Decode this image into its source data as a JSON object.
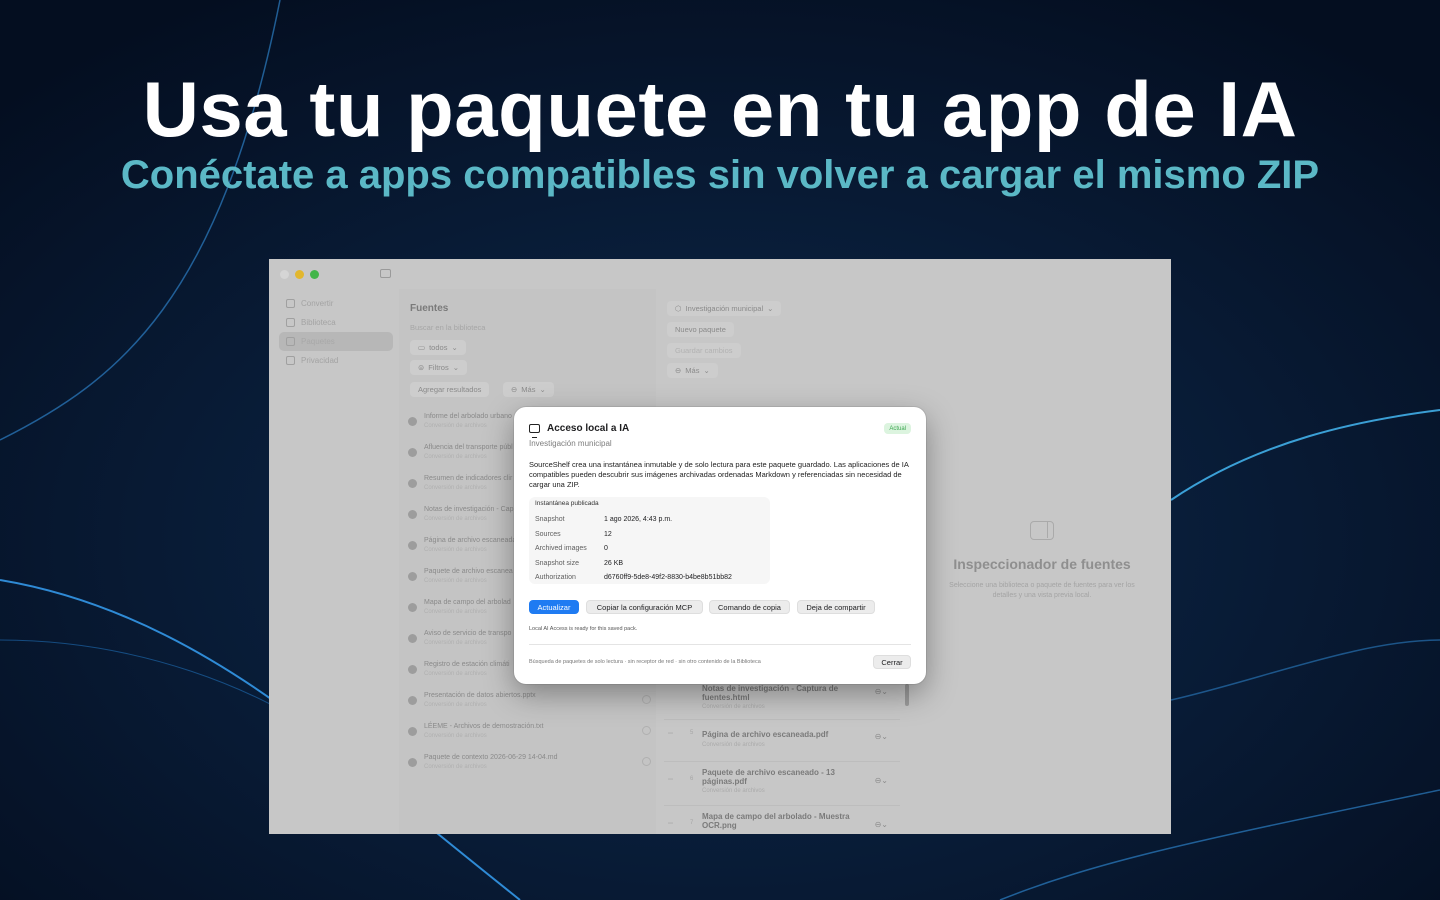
{
  "hero": {
    "headline": "Usa tu paquete en tu app de IA",
    "subheadline": "Conéctate a apps compatibles sin volver a cargar el mismo ZIP"
  },
  "colors": {
    "background": "#06142b",
    "accent_teal": "#5bb8c6",
    "primary_blue": "#1f7bf2",
    "badge_green": "#3ca650"
  },
  "sidebar": {
    "items": [
      {
        "label": "Convertir",
        "icon": "doc-icon"
      },
      {
        "label": "Biblioteca",
        "icon": "library-icon"
      },
      {
        "label": "Paquetes",
        "icon": "package-icon"
      },
      {
        "label": "Privacidad",
        "icon": "shield-icon"
      }
    ]
  },
  "sources": {
    "title": "Fuentes",
    "search_placeholder": "Buscar en la biblioteca",
    "filter_all": "todos",
    "filters": "Filtros",
    "add_results": "Agregar resultados",
    "more": "Más",
    "items": [
      {
        "title": "Informe del arbolado urbano",
        "sub": "Conversión de archivos"
      },
      {
        "title": "Afluencia del transporte públ",
        "sub": "Conversión de archivos"
      },
      {
        "title": "Resumen de indicadores clir",
        "sub": "Conversión de archivos"
      },
      {
        "title": "Notas de investigación - Cap",
        "sub": "Conversión de archivos"
      },
      {
        "title": "Página de archivo escaneada",
        "sub": "Conversión de archivos"
      },
      {
        "title": "Paquete de archivo escanea",
        "sub": "Conversión de archivos"
      },
      {
        "title": "Mapa de campo del arbolad",
        "sub": "Conversión de archivos"
      },
      {
        "title": "Aviso de servicio de transpo",
        "sub": "Conversión de archivos"
      },
      {
        "title": "Registro de estación climáti",
        "sub": "Conversión de archivos"
      },
      {
        "title": "Presentación de datos abiertos.pptx",
        "sub": "Conversión de archivos"
      },
      {
        "title": "LÉEME - Archivos de demostración.txt",
        "sub": "Conversión de archivos"
      },
      {
        "title": "Paquete de contexto 2026-06-29 14-04.md",
        "sub": "Conversión de archivos"
      }
    ]
  },
  "pack": {
    "selector": "Investigación municipal",
    "new_pack": "Nuevo paquete",
    "save_changes": "Guardar cambios",
    "more": "Más",
    "items": [
      {
        "num": "4",
        "title": "Notas de investigación - Captura de fuentes.html",
        "sub": "Conversión de archivos"
      },
      {
        "num": "5",
        "title": "Página de archivo escaneada.pdf",
        "sub": "Conversión de archivos"
      },
      {
        "num": "6",
        "title": "Paquete de archivo escaneado - 13 páginas.pdf",
        "sub": "Conversión de archivos"
      },
      {
        "num": "7",
        "title": "Mapa de campo del arbolado - Muestra OCR.png",
        "sub": ""
      }
    ]
  },
  "inspector": {
    "title": "Inspeccionador de fuentes",
    "text": "Seleccione una biblioteca o paquete de fuentes para ver los detalles y una vista previa local."
  },
  "modal": {
    "title": "Acceso local a IA",
    "badge": "Actual",
    "subtitle": "Investigación municipal",
    "description": "SourceShelf crea una instantánea inmutable y de solo lectura para este paquete guardado. Las aplicaciones de IA compatibles pueden descubrir sus imágenes archivadas ordenadas Markdown y referenciadas sin necesidad de cargar una ZIP.",
    "snapshot_box_title": "Instantánea publicada",
    "fields": [
      {
        "label": "Snapshot",
        "value": "1 ago 2026, 4:43 p.m."
      },
      {
        "label": "Sources",
        "value": "12"
      },
      {
        "label": "Archived images",
        "value": "0"
      },
      {
        "label": "Snapshot size",
        "value": "26 KB"
      },
      {
        "label": "Authorization",
        "value": "d6760ff9-5de8-49f2-8830-b4be8b51bb82"
      }
    ],
    "buttons": {
      "update": "Actualizar",
      "copy_mcp": "Copiar la configuración MCP",
      "copy_command": "Comando de copia",
      "stop_sharing": "Deja de compartir"
    },
    "status": "Local AI Access is ready for this saved pack.",
    "footer": "Búsqueda de paquetes de solo lectura · sin receptor de red · sin otro contenido de la Biblioteca",
    "close": "Cerrar"
  }
}
